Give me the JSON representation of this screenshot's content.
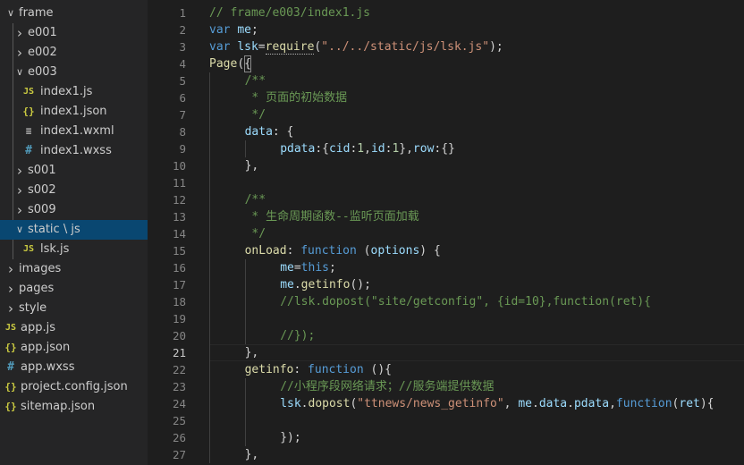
{
  "explorer": {
    "items": [
      {
        "label": "frame",
        "kind": "folder",
        "expanded": true,
        "depth": 0
      },
      {
        "label": "e001",
        "kind": "folder",
        "expanded": false,
        "depth": 1
      },
      {
        "label": "e002",
        "kind": "folder",
        "expanded": false,
        "depth": 1
      },
      {
        "label": "e003",
        "kind": "folder",
        "expanded": true,
        "depth": 1
      },
      {
        "label": "index1.js",
        "kind": "file",
        "icon": "JS",
        "iconType": "js",
        "depth": 2
      },
      {
        "label": "index1.json",
        "kind": "file",
        "icon": "{}",
        "iconType": "json",
        "depth": 2
      },
      {
        "label": "index1.wxml",
        "kind": "file",
        "icon": "≡",
        "iconType": "wxml",
        "depth": 2
      },
      {
        "label": "index1.wxss",
        "kind": "file",
        "icon": "#",
        "iconType": "wxss",
        "depth": 2
      },
      {
        "label": "s001",
        "kind": "folder",
        "expanded": false,
        "depth": 1
      },
      {
        "label": "s002",
        "kind": "folder",
        "expanded": false,
        "depth": 1
      },
      {
        "label": "s009",
        "kind": "folder",
        "expanded": false,
        "depth": 1
      },
      {
        "label": "static \\ js",
        "kind": "folder",
        "expanded": true,
        "depth": 1,
        "selected": true
      },
      {
        "label": "lsk.js",
        "kind": "file",
        "icon": "JS",
        "iconType": "js",
        "depth": 2
      },
      {
        "label": "images",
        "kind": "folder",
        "expanded": false,
        "depth": 0
      },
      {
        "label": "pages",
        "kind": "folder",
        "expanded": false,
        "depth": 0
      },
      {
        "label": "style",
        "kind": "folder",
        "expanded": false,
        "depth": 0
      },
      {
        "label": "app.js",
        "kind": "file",
        "icon": "JS",
        "iconType": "js",
        "depth": -1
      },
      {
        "label": "app.json",
        "kind": "file",
        "icon": "{}",
        "iconType": "json",
        "depth": -1
      },
      {
        "label": "app.wxss",
        "kind": "file",
        "icon": "#",
        "iconType": "wxss",
        "depth": -1
      },
      {
        "label": "project.config.json",
        "kind": "file",
        "icon": "{}",
        "iconType": "json",
        "depth": -1
      },
      {
        "label": "sitemap.json",
        "kind": "file",
        "icon": "{}",
        "iconType": "json",
        "depth": -1
      }
    ]
  },
  "colors": {
    "keyword": "#569cd6",
    "variable": "#9cdcfe",
    "function": "#dcdcaa",
    "string": "#ce9178",
    "comment": "#6a9955",
    "number": "#b5cea8",
    "plain": "#d4d4d4"
  },
  "editor": {
    "current_line": 21,
    "lines": [
      {
        "n": "1",
        "indent": 0,
        "tokens": [
          {
            "t": "// frame/e003/index1.js",
            "c": "comment"
          }
        ]
      },
      {
        "n": "2",
        "indent": 0,
        "tokens": [
          {
            "t": "var ",
            "c": "keyword"
          },
          {
            "t": "me",
            "c": "variable"
          },
          {
            "t": ";",
            "c": "plain"
          }
        ]
      },
      {
        "n": "3",
        "indent": 0,
        "tokens": [
          {
            "t": "var ",
            "c": "keyword"
          },
          {
            "t": "lsk",
            "c": "variable"
          },
          {
            "t": "=",
            "c": "plain"
          },
          {
            "t": "require",
            "c": "function",
            "squiggle": true
          },
          {
            "t": "(",
            "c": "plain"
          },
          {
            "t": "\"../../static/js/lsk.js\"",
            "c": "string"
          },
          {
            "t": ");",
            "c": "plain"
          }
        ]
      },
      {
        "n": "4",
        "indent": 0,
        "tokens": [
          {
            "t": "Page",
            "c": "function"
          },
          {
            "t": "(",
            "c": "plain"
          },
          {
            "t": "{",
            "c": "plain",
            "box": true
          }
        ]
      },
      {
        "n": "5",
        "indent": 1,
        "tokens": [
          {
            "t": "/**",
            "c": "comment"
          }
        ]
      },
      {
        "n": "6",
        "indent": 1,
        "tokens": [
          {
            "t": " * 页面的初始数据",
            "c": "comment"
          }
        ]
      },
      {
        "n": "7",
        "indent": 1,
        "tokens": [
          {
            "t": " */",
            "c": "comment"
          }
        ]
      },
      {
        "n": "8",
        "indent": 1,
        "tokens": [
          {
            "t": "data",
            "c": "variable"
          },
          {
            "t": ": {",
            "c": "plain"
          }
        ]
      },
      {
        "n": "9",
        "indent": 2,
        "tokens": [
          {
            "t": "pdata",
            "c": "variable"
          },
          {
            "t": ":{",
            "c": "plain"
          },
          {
            "t": "cid",
            "c": "variable"
          },
          {
            "t": ":",
            "c": "plain"
          },
          {
            "t": "1",
            "c": "number"
          },
          {
            "t": ",",
            "c": "plain"
          },
          {
            "t": "id",
            "c": "variable"
          },
          {
            "t": ":",
            "c": "plain"
          },
          {
            "t": "1",
            "c": "number"
          },
          {
            "t": "},",
            "c": "plain"
          },
          {
            "t": "row",
            "c": "variable"
          },
          {
            "t": ":{}",
            "c": "plain"
          }
        ]
      },
      {
        "n": "10",
        "indent": 1,
        "tokens": [
          {
            "t": "},",
            "c": "plain"
          }
        ]
      },
      {
        "n": "11",
        "indent": 0,
        "tokens": []
      },
      {
        "n": "12",
        "indent": 1,
        "tokens": [
          {
            "t": "/**",
            "c": "comment"
          }
        ]
      },
      {
        "n": "13",
        "indent": 1,
        "tokens": [
          {
            "t": " * 生命周期函数--监听页面加载",
            "c": "comment"
          }
        ]
      },
      {
        "n": "14",
        "indent": 1,
        "tokens": [
          {
            "t": " */",
            "c": "comment"
          }
        ]
      },
      {
        "n": "15",
        "indent": 1,
        "tokens": [
          {
            "t": "onLoad",
            "c": "function"
          },
          {
            "t": ": ",
            "c": "plain"
          },
          {
            "t": "function",
            "c": "keyword"
          },
          {
            "t": " (",
            "c": "plain"
          },
          {
            "t": "options",
            "c": "variable"
          },
          {
            "t": ") {",
            "c": "plain"
          }
        ]
      },
      {
        "n": "16",
        "indent": 2,
        "tokens": [
          {
            "t": "me",
            "c": "variable"
          },
          {
            "t": "=",
            "c": "plain"
          },
          {
            "t": "this",
            "c": "keyword"
          },
          {
            "t": ";",
            "c": "plain"
          }
        ]
      },
      {
        "n": "17",
        "indent": 2,
        "tokens": [
          {
            "t": "me",
            "c": "variable"
          },
          {
            "t": ".",
            "c": "plain"
          },
          {
            "t": "getinfo",
            "c": "function"
          },
          {
            "t": "();",
            "c": "plain"
          }
        ]
      },
      {
        "n": "18",
        "indent": 2,
        "tokens": [
          {
            "t": "//lsk.dopost(\"site/getconfig\", {id=10},function(ret){",
            "c": "comment"
          }
        ]
      },
      {
        "n": "19",
        "indent": 0,
        "tokens": []
      },
      {
        "n": "20",
        "indent": 2,
        "tokens": [
          {
            "t": "//});",
            "c": "comment"
          }
        ]
      },
      {
        "n": "21",
        "indent": 1,
        "tokens": [
          {
            "t": "},",
            "c": "plain"
          }
        ]
      },
      {
        "n": "22",
        "indent": 1,
        "tokens": [
          {
            "t": "getinfo",
            "c": "function"
          },
          {
            "t": ": ",
            "c": "plain"
          },
          {
            "t": "function",
            "c": "keyword"
          },
          {
            "t": " (){",
            "c": "plain"
          }
        ]
      },
      {
        "n": "23",
        "indent": 2,
        "tokens": [
          {
            "t": "//小程序段网络请求；//服务端提供数据",
            "c": "comment"
          }
        ]
      },
      {
        "n": "24",
        "indent": 2,
        "tokens": [
          {
            "t": "lsk",
            "c": "variable"
          },
          {
            "t": ".",
            "c": "plain"
          },
          {
            "t": "dopost",
            "c": "function"
          },
          {
            "t": "(",
            "c": "plain"
          },
          {
            "t": "\"ttnews/news_getinfo\"",
            "c": "string"
          },
          {
            "t": ", ",
            "c": "plain"
          },
          {
            "t": "me",
            "c": "variable"
          },
          {
            "t": ".",
            "c": "plain"
          },
          {
            "t": "data",
            "c": "variable"
          },
          {
            "t": ".",
            "c": "plain"
          },
          {
            "t": "pdata",
            "c": "variable"
          },
          {
            "t": ",",
            "c": "plain"
          },
          {
            "t": "function",
            "c": "keyword"
          },
          {
            "t": "(",
            "c": "plain"
          },
          {
            "t": "ret",
            "c": "variable"
          },
          {
            "t": "){",
            "c": "plain"
          }
        ]
      },
      {
        "n": "25",
        "indent": 0,
        "tokens": []
      },
      {
        "n": "26",
        "indent": 2,
        "tokens": [
          {
            "t": "});",
            "c": "plain"
          }
        ]
      },
      {
        "n": "27",
        "indent": 1,
        "tokens": [
          {
            "t": "},",
            "c": "plain"
          }
        ]
      }
    ]
  }
}
